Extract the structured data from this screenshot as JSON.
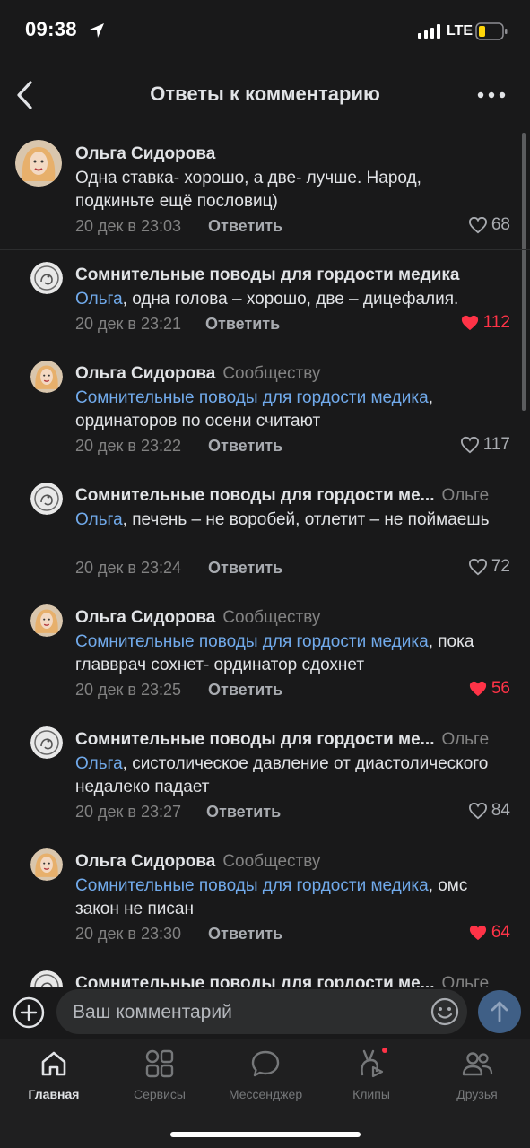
{
  "status": {
    "time": "09:38",
    "network": "LTE",
    "icons": [
      "location-arrow-icon",
      "signal-icon",
      "battery-icon"
    ]
  },
  "header": {
    "title": "Ответы к комментарию",
    "icons": [
      "back-arrow-icon",
      "more-dots-icon"
    ]
  },
  "comments": [
    {
      "author": "Ольга Сидорова",
      "to": "",
      "mention": "",
      "text": "Одна ставка- хорошо, а две- лучше. Народ, подкиньте ещё пословиц)",
      "date": "20 дек в 23:03",
      "reply": "Ответить",
      "likes": "68",
      "liked": false,
      "avatar": "olga-avatar"
    },
    {
      "author": "Сомнительные поводы для гордости медика",
      "to": "",
      "mention": "Ольга",
      "text": ", одна голова – хорошо, две – дицефалия.",
      "date": "20 дек в 23:21",
      "reply": "Ответить",
      "likes": "112",
      "liked": true,
      "avatar": "community-avatar"
    },
    {
      "author": "Ольга Сидорова",
      "to": "Сообществу",
      "mention": "Сомнительные поводы для гордости медика",
      "text": ", ординаторов по осени считают",
      "date": "20 дек в 23:22",
      "reply": "Ответить",
      "likes": "117",
      "liked": false,
      "avatar": "olga-avatar"
    },
    {
      "author": "Сомнительные поводы для гордости ме...",
      "to": "Ольге",
      "mention": "Ольга",
      "text": ", печень – не воробей, отлетит – не поймаешь",
      "date": "20 дек в 23:24",
      "reply": "Ответить",
      "likes": "72",
      "liked": false,
      "avatar": "community-avatar"
    },
    {
      "author": "Ольга Сидорова",
      "to": "Сообществу",
      "mention": "Сомнительные поводы для гордости медика",
      "text": ", пока главврач сохнет- ординатор сдохнет",
      "date": "20 дек в 23:25",
      "reply": "Ответить",
      "likes": "56",
      "liked": true,
      "avatar": "olga-avatar"
    },
    {
      "author": "Сомнительные поводы для гордости ме...",
      "to": "Ольге",
      "mention": "Ольга",
      "text": ", систолическое давление от диастолического недалеко падает",
      "date": "20 дек в 23:27",
      "reply": "Ответить",
      "likes": "84",
      "liked": false,
      "avatar": "community-avatar"
    },
    {
      "author": "Ольга Сидорова",
      "to": "Сообществу",
      "mention": "Сомнительные поводы для гордости медика",
      "text": ", омс закон не писан",
      "date": "20 дек в 23:30",
      "reply": "Ответить",
      "likes": "64",
      "liked": true,
      "avatar": "olga-avatar"
    },
    {
      "author": "Сомнительные поводы для гордости ме...",
      "to": "Ольге",
      "mention": "",
      "text": "",
      "date": "",
      "reply": "",
      "likes": "",
      "liked": false,
      "avatar": "community-avatar"
    }
  ],
  "composer": {
    "placeholder": "Ваш комментарий",
    "icons": [
      "plus-circle-icon",
      "emoji-icon",
      "send-arrow-icon"
    ]
  },
  "tabs": [
    {
      "label": "Главная",
      "icon": "home-icon",
      "active": true
    },
    {
      "label": "Сервисы",
      "icon": "services-grid-icon",
      "active": false
    },
    {
      "label": "Мессенджер",
      "icon": "messenger-bubble-icon",
      "active": false
    },
    {
      "label": "Клипы",
      "icon": "clips-icon",
      "active": false
    },
    {
      "label": "Друзья",
      "icon": "friends-icon",
      "active": false
    }
  ],
  "colors": {
    "background": "#19191a",
    "mention": "#71aaeb",
    "like_active": "#ff3347",
    "secondary_text": "#828282",
    "tabbar": "#1f1f20"
  }
}
